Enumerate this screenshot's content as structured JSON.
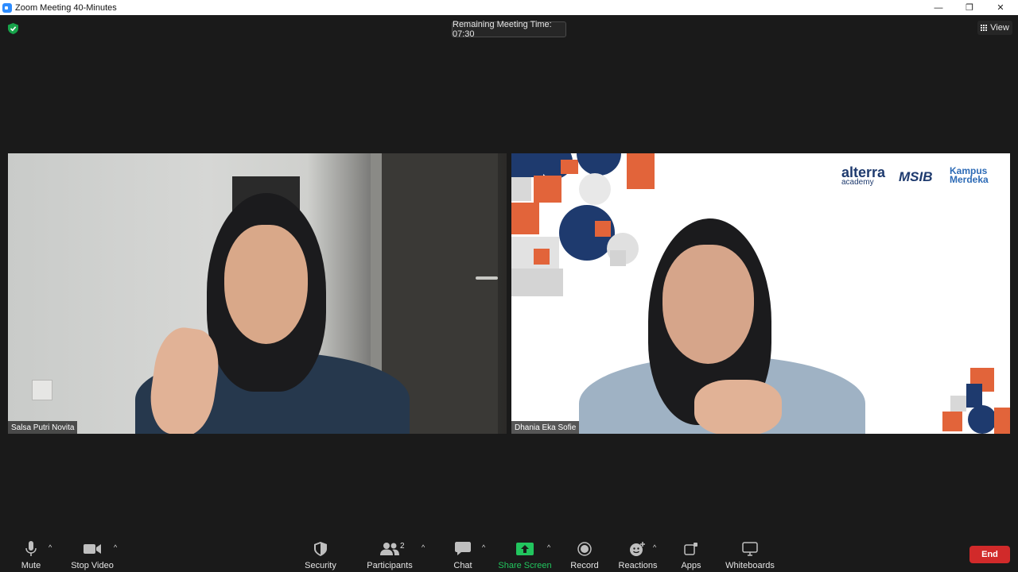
{
  "window": {
    "title": "Zoom Meeting 40-Minutes",
    "controls": [
      "minimize",
      "restore",
      "close"
    ]
  },
  "meeting": {
    "remaining_time_label": "Remaining Meeting Time: 07:30",
    "view_label": "View"
  },
  "participants": [
    {
      "name": "Salsa Putri Novita"
    },
    {
      "name": "Dhania Eka Sofie"
    }
  ],
  "background_logos": {
    "alterra": "alterra",
    "alterra_sub": "academy",
    "msib": "MSIB",
    "kampus_line1": "Kampus",
    "kampus_line2": "Merdeka"
  },
  "toolbar": {
    "mute": "Mute",
    "stop_video": "Stop Video",
    "security": "Security",
    "participants": "Participants",
    "participants_count": "2",
    "chat": "Chat",
    "share_screen": "Share Screen",
    "record": "Record",
    "reactions": "Reactions",
    "apps": "Apps",
    "whiteboards": "Whiteboards",
    "end": "End"
  },
  "colors": {
    "background": "#1a1a1a",
    "share_green": "#22c55e",
    "end_red": "#d12a2a",
    "secure_green": "#17a34a"
  }
}
